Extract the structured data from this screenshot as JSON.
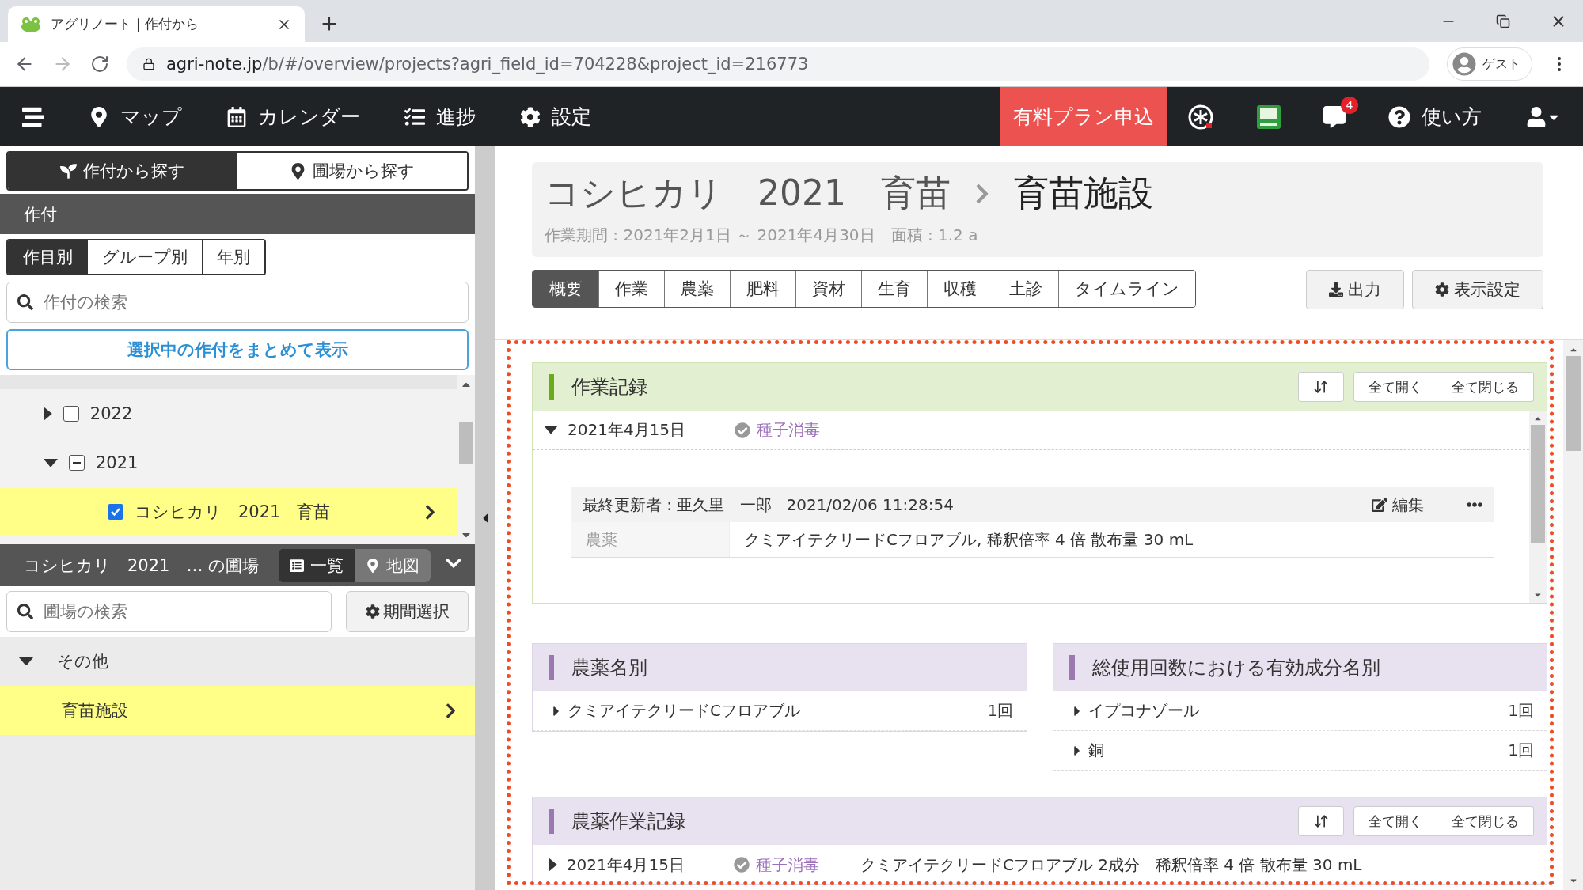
{
  "browser": {
    "tab_title": "アグリノート｜作付から",
    "url_host": "agri-note.jp",
    "url_path": "/b/#/overview/projects?agri_field_id=704228&project_id=216773",
    "profile": "ゲスト"
  },
  "nav": {
    "items": [
      {
        "kind": "map",
        "label": "マップ"
      },
      {
        "kind": "calendar",
        "label": "カレンダー"
      },
      {
        "kind": "progress",
        "label": "進捗"
      },
      {
        "kind": "settings",
        "label": "設定"
      }
    ],
    "cta": "有料プラン申込",
    "notifications": "4",
    "help": "使い方"
  },
  "sidebar": {
    "mode_tabs": [
      {
        "kind": "crop",
        "label": "作付から探す",
        "selected": true
      },
      {
        "kind": "field",
        "label": "圃場から探す",
        "selected": false
      }
    ],
    "section_title": "作付",
    "view_tabs": [
      {
        "label": "作目別",
        "selected": true
      },
      {
        "label": "グループ別",
        "selected": false
      },
      {
        "label": "年別",
        "selected": false
      }
    ],
    "search_placeholder": "作付の検索",
    "combine_button": "選択中の作付をまとめて表示",
    "tree": [
      {
        "label": "2022",
        "expanded": false,
        "checked": false,
        "partial": false
      },
      {
        "label": "2021",
        "expanded": true,
        "checked": false,
        "partial": true,
        "children": [
          {
            "label": "コシヒカリ　2021　育苗",
            "checked": true,
            "selected": true
          }
        ]
      }
    ],
    "field_panel": {
      "title": "コシヒカリ　2021　… の圃場",
      "view_tabs": [
        {
          "kind": "list",
          "label": "一覧",
          "selected": true
        },
        {
          "kind": "map",
          "label": "地図",
          "selected": false
        }
      ],
      "search_placeholder": "圃場の検索",
      "period_button": "期間選択",
      "groups": [
        {
          "label": "その他",
          "expanded": true,
          "children": [
            {
              "label": "育苗施設",
              "selected": true
            }
          ]
        }
      ]
    }
  },
  "main": {
    "header": {
      "crop": "コシヒカリ　2021　育苗",
      "field": "育苗施設",
      "meta": "作業期間 : 2021年2月1日 ～ 2021年4月30日　面積 : 1.2 a"
    },
    "tabs": [
      {
        "label": "概要",
        "selected": true
      },
      {
        "label": "作業",
        "selected": false
      },
      {
        "label": "農薬",
        "selected": false
      },
      {
        "label": "肥料",
        "selected": false
      },
      {
        "label": "資材",
        "selected": false
      },
      {
        "label": "生育",
        "selected": false
      },
      {
        "label": "収穫",
        "selected": false
      },
      {
        "label": "土診",
        "selected": false
      },
      {
        "label": "タイムライン",
        "selected": false
      }
    ],
    "actions": [
      {
        "kind": "download",
        "label": "出力"
      },
      {
        "kind": "settings",
        "label": "表示設定"
      }
    ],
    "work_log": {
      "title": "作業記録",
      "expand_all": "全て開く",
      "collapse_all": "全て閉じる",
      "entries": [
        {
          "date": "2021年4月15日",
          "expanded": true,
          "task": "種子消毒",
          "updated_by": "最終更新者 : 亜久里　一郎",
          "timestamp": "2021/02/06 11:28:54",
          "edit": "編集",
          "rows": [
            {
              "label": "農薬",
              "value": "クミアイテクリードCフロアブル, 稀釈倍率 4 倍 散布量 30 mL"
            }
          ]
        }
      ]
    },
    "summaries": [
      {
        "title": "農薬名別",
        "rows": [
          {
            "name": "クミアイテクリードCフロアブル",
            "count": "1回"
          }
        ]
      },
      {
        "title": "総使用回数における有効成分名別",
        "rows": [
          {
            "name": "イプコナゾール",
            "count": "1回"
          },
          {
            "name": "銅",
            "count": "1回"
          }
        ]
      }
    ],
    "pesticide_log": {
      "title": "農薬作業記録",
      "expand_all": "全て開く",
      "collapse_all": "全て閉じる",
      "entries": [
        {
          "date": "2021年4月15日",
          "expanded": false,
          "task": "種子消毒",
          "detail": "クミアイテクリードCフロアブル 2成分　稀釈倍率 4 倍 散布量 30 mL"
        }
      ]
    }
  }
}
